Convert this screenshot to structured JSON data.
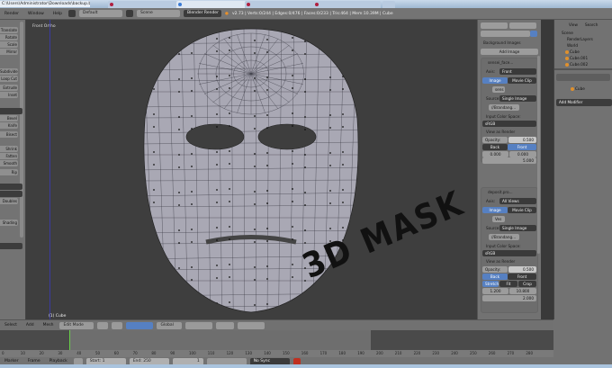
{
  "browser": {
    "path": "C:\\Users\\Administrator\\Downloads\\backup.blend]",
    "tabs": [
      "",
      "",
      "",
      "",
      ""
    ]
  },
  "header": {
    "menus": [
      "Render",
      "Window",
      "Help"
    ],
    "layout": "Default",
    "scene": "Scene",
    "engine": "Blender Render",
    "info": "v2.73 | Verts:0/244 | Edges:0/476 | Faces:0/233 | Tris:464 | Mem:10.39M | Cube"
  },
  "left_tools": [
    "Translate",
    "Rotate",
    "Scale",
    "Mirror",
    "Subdivide",
    "Loop Cut",
    "Extrude",
    "Inset",
    "Bevel",
    "Knife",
    "Bisect",
    "Shrink",
    "Fatten",
    "Smooth",
    "Rip",
    "Split",
    "Remove",
    "Merge",
    "Doubles",
    "Shading",
    "Smooth",
    "Flat"
  ],
  "viewport": {
    "label": "Front Ortho",
    "object": "(1) Cube",
    "stamp": "3D MASK",
    "mesh_color": "#a9a8b4"
  },
  "npanel": {
    "bg_images": "Background Images",
    "add_image": "Add Image",
    "img1": {
      "name": "sensei_face...",
      "axis_label": "Axis:",
      "axis": "Front",
      "tab_image": "Image",
      "tab_clip": "Movie Clip",
      "img_field": "sens",
      "source_label": "Source:",
      "source": "Single Image",
      "file": "//Brandang...",
      "ics_label": "Input Color Space:",
      "ics": "sRGB",
      "view_render": "View as Render",
      "opacity_label": "Opacity:",
      "opacity": "0.500",
      "back": "Back",
      "front": "Front",
      "x": "0.000",
      "y": "0.000",
      "size_label": "Size:",
      "size": "5.000"
    },
    "img2": {
      "name": "deposit.pro...",
      "axis_label": "Axis:",
      "axis": "All Views",
      "tab_image": "Image",
      "tab_clip": "Movie Clip",
      "img_field": "Ves",
      "source_label": "Source:",
      "source": "Single Image",
      "file": "//Brandang...",
      "ics_label": "Input Color Space:",
      "ics": "sRGB",
      "view_render": "View as Render",
      "opacity_label": "Opacity:",
      "opacity": "0.500",
      "back": "Back",
      "front": "Front",
      "stretch": "Stretch",
      "fit": "Fit",
      "crop": "Crop",
      "x": "1.200",
      "y": "10.800",
      "size_label": "Size:",
      "size": "2.000"
    }
  },
  "outliner": {
    "view": "View",
    "search": "Search",
    "items": [
      "Scene",
      "RenderLayers",
      "World",
      "Cube",
      "Cube.001",
      "Cube.002"
    ],
    "obj": "Cube",
    "add_modifier": "Add Modifier"
  },
  "view_header": {
    "menus": [
      "Select",
      "Add",
      "Mesh"
    ],
    "mode": "Edit Mode",
    "orientation": "Global"
  },
  "ruler": [
    "0",
    "10",
    "20",
    "30",
    "40",
    "50",
    "60",
    "70",
    "80",
    "90",
    "100",
    "110",
    "120",
    "130",
    "140",
    "150",
    "160",
    "170",
    "180",
    "190",
    "200",
    "210",
    "220",
    "230",
    "240",
    "250",
    "260",
    "270",
    "280"
  ],
  "timeline": {
    "menus": [
      "Marker",
      "Frame",
      "Playback"
    ],
    "start_label": "Start:",
    "start": "1",
    "end_label": "End:",
    "end": "250",
    "current": "1",
    "sync": "No Sync"
  }
}
